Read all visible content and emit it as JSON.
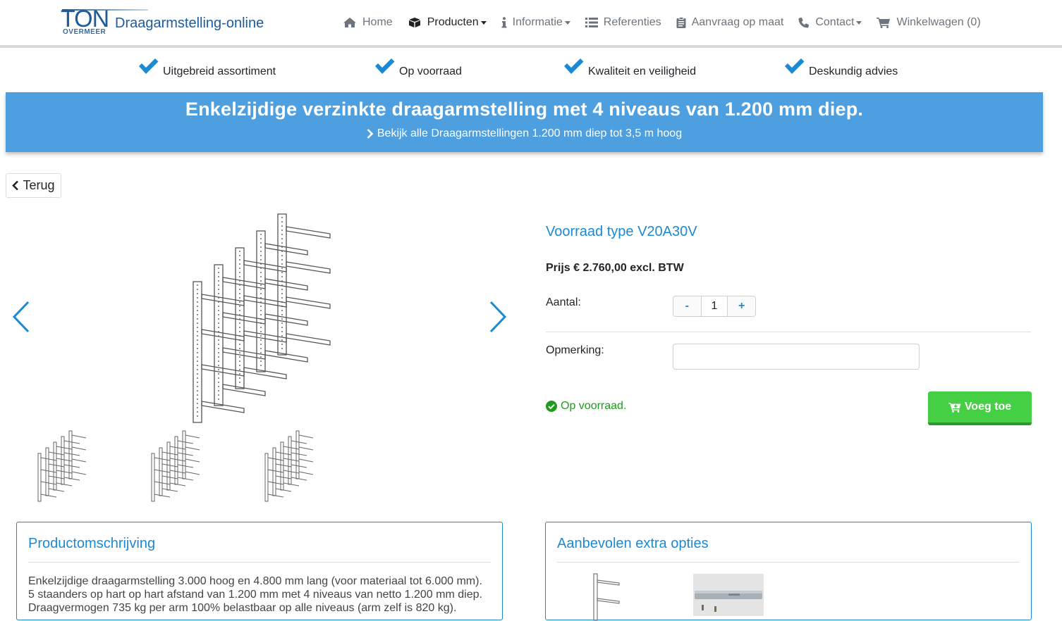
{
  "logo": {
    "ton": "TON",
    "overmeer": "OVERMEER",
    "brand": "Draagarmstelling-online"
  },
  "nav": [
    {
      "label": "Home",
      "icon": "home-icon"
    },
    {
      "label": "Producten",
      "icon": "box-icon",
      "active": true
    },
    {
      "label": "Informatie",
      "icon": "info-icon"
    },
    {
      "label": "Referenties",
      "icon": "list-icon"
    },
    {
      "label": "Aanvraag op maat",
      "icon": "clipboard-icon"
    },
    {
      "label": "Contact",
      "icon": "phone-icon"
    },
    {
      "label": "Winkelwagen (0)",
      "icon": "cart-icon"
    }
  ],
  "usps": [
    "Uitgebreid assortiment",
    "Op voorraad",
    "Kwaliteit en veiligheid",
    "Deskundig advies"
  ],
  "banner": {
    "title": "Enkelzijdige verzinkte draagarmstelling met 4 niveaus van 1.200 mm diep.",
    "link": "Bekijk alle Draagarmstellingen 1.200 mm diep tot 3,5 m hoog"
  },
  "back_label": "Terug",
  "product": {
    "type": "Voorraad type V20A30V",
    "price": "Prijs € 2.760,00 excl. BTW",
    "qty_label": "Aantal:",
    "qty_minus": "-",
    "qty_value": "1",
    "qty_plus": "+",
    "remark_label": "Opmerking:",
    "remark_value": "",
    "stock": "Op voorraad.",
    "add_label": "Voeg toe"
  },
  "description": {
    "title": "Productomschrijving",
    "lines": [
      "Enkelzijdige draagarmstelling 3.000 hoog en 4.800 mm lang (voor materiaal tot 6.000 mm).",
      "5 staanders op hart op hart afstand van 1.200 mm met 4 niveaus van netto 1.200 mm diep.",
      "Draagvermogen 735 kg per arm 100% belastbaar op alle niveaus (arm zelf is 820 kg)."
    ]
  },
  "options": {
    "title": "Aanbevolen extra opties"
  },
  "colors": {
    "accent": "#1a8ad4",
    "banner": "#4d9fdf",
    "success": "#44cf44",
    "stock": "#1e9b1e"
  }
}
